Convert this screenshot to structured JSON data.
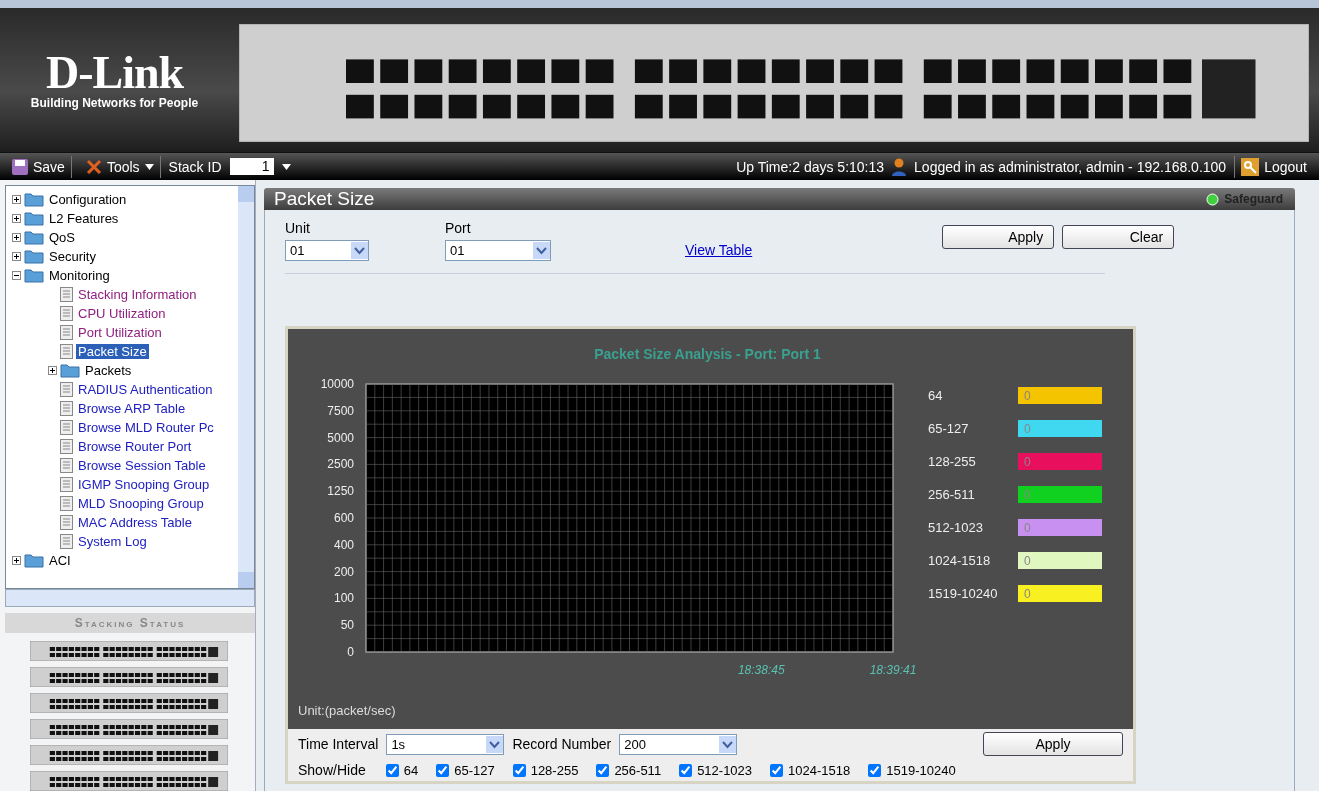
{
  "header": {
    "logo": "D-Link",
    "tagline": "Building Networks for People"
  },
  "toolbar": {
    "save": "Save",
    "tools": "Tools",
    "stack_id_label": "Stack ID",
    "stack_id": "1",
    "uptime": "Up Time:2 days 5:10:13",
    "login": "Logged in as administrator, admin - 192.168.0.100",
    "logout": "Logout"
  },
  "sidebar": {
    "tree": [
      {
        "label": "Configuration",
        "kind": "folder",
        "expanded": false
      },
      {
        "label": "L2 Features",
        "kind": "folder",
        "expanded": false
      },
      {
        "label": "QoS",
        "kind": "folder",
        "expanded": false
      },
      {
        "label": "Security",
        "kind": "folder",
        "expanded": false
      },
      {
        "label": "Monitoring",
        "kind": "folder",
        "expanded": true,
        "children": [
          {
            "label": "Stacking Information",
            "kind": "page",
            "visited": true,
            "selected": false
          },
          {
            "label": "CPU Utilization",
            "kind": "page",
            "visited": true,
            "selected": false
          },
          {
            "label": "Port Utilization",
            "kind": "page",
            "visited": true,
            "selected": false
          },
          {
            "label": "Packet Size",
            "kind": "page",
            "visited": true,
            "selected": true
          },
          {
            "label": "Packets",
            "kind": "folder",
            "expanded": false
          },
          {
            "label": "RADIUS Authentication",
            "kind": "page",
            "visited": false,
            "selected": false
          },
          {
            "label": "Browse ARP Table",
            "kind": "page",
            "visited": false,
            "selected": false
          },
          {
            "label": "Browse MLD Router Pc",
            "kind": "page",
            "visited": false,
            "selected": false
          },
          {
            "label": "Browse Router Port",
            "kind": "page",
            "visited": false,
            "selected": false
          },
          {
            "label": "Browse Session Table",
            "kind": "page",
            "visited": false,
            "selected": false
          },
          {
            "label": "IGMP Snooping Group",
            "kind": "page",
            "visited": false,
            "selected": false
          },
          {
            "label": "MLD Snooping Group",
            "kind": "page",
            "visited": false,
            "selected": false
          },
          {
            "label": "MAC Address Table",
            "kind": "page",
            "visited": false,
            "selected": false
          },
          {
            "label": "System Log",
            "kind": "page",
            "visited": false,
            "selected": false
          }
        ]
      },
      {
        "label": "ACI",
        "kind": "folder",
        "expanded": false
      }
    ],
    "stacking_title": "Stacking Status"
  },
  "panel": {
    "title": "Packet Size",
    "safeguard": "Safeguard",
    "unit_label": "Unit",
    "unit": "01",
    "port_label": "Port",
    "port": "01",
    "view_table": "View Table",
    "apply": "Apply",
    "clear": "Clear",
    "chart": {
      "title": "Packet Size Analysis  - Port: Port 1",
      "unit_label": "Unit:(packet/sec)",
      "y_labels": [
        "10000",
        "7500",
        "5000",
        "2500",
        "1250",
        "600",
        "400",
        "200",
        "100",
        "50",
        "0"
      ],
      "time_labels": [
        "18:38:45",
        "18:39:41"
      ]
    },
    "legend": [
      {
        "label": "64",
        "value": "0",
        "color": "#f5c400"
      },
      {
        "label": "65-127",
        "value": "0",
        "color": "#40d8f0"
      },
      {
        "label": "128-255",
        "value": "0",
        "color": "#e8105c"
      },
      {
        "label": "256-511",
        "value": "0",
        "color": "#10d020"
      },
      {
        "label": "512-1023",
        "value": "0",
        "color": "#c890f0"
      },
      {
        "label": "1024-1518",
        "value": "0",
        "color": "#e0f8c0"
      },
      {
        "label": "1519-10240",
        "value": "0",
        "color": "#f8f020"
      }
    ],
    "time_interval_label": "Time Interval",
    "time_interval": "1s",
    "record_number_label": "Record Number",
    "record_number": "200",
    "chart_apply": "Apply",
    "show_hide_label": "Show/Hide",
    "show_hide": [
      {
        "label": "64",
        "checked": true
      },
      {
        "label": "65-127",
        "checked": true
      },
      {
        "label": "128-255",
        "checked": true
      },
      {
        "label": "256-511",
        "checked": true
      },
      {
        "label": "512-1023",
        "checked": true
      },
      {
        "label": "1024-1518",
        "checked": true
      },
      {
        "label": "1519-10240",
        "checked": true
      }
    ]
  }
}
